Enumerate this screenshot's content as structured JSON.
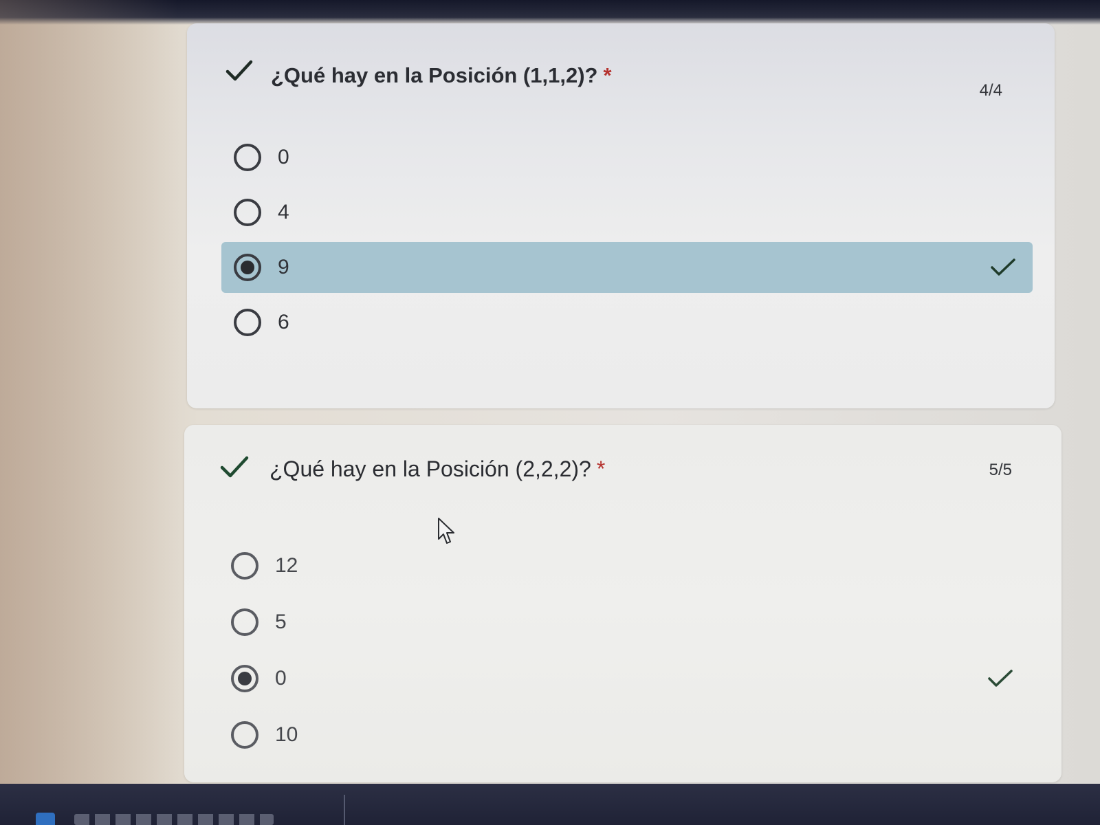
{
  "questions": [
    {
      "title": "¿Qué hay en la  Posición (1,1,2)?",
      "required_mark": "*",
      "score": "4/4",
      "options": [
        {
          "label": "0",
          "selected": false
        },
        {
          "label": "4",
          "selected": false
        },
        {
          "label": "9",
          "selected": true,
          "correct": true
        },
        {
          "label": "6",
          "selected": false
        }
      ]
    },
    {
      "title": "¿Qué hay en la Posición (2,2,2)?",
      "required_mark": "*",
      "score": "5/5",
      "options": [
        {
          "label": "12",
          "selected": false
        },
        {
          "label": "5",
          "selected": false
        },
        {
          "label": "0",
          "selected": true,
          "correct": true
        },
        {
          "label": "10",
          "selected": false
        }
      ]
    }
  ],
  "icons": {
    "title_check": "checkmark-icon",
    "option_check": "checkmark-icon",
    "cursor": "mouse-pointer-icon"
  },
  "colors": {
    "correct_highlight": "#a6c4d0",
    "required_mark": "#b5322e",
    "check_color": "#1f3b2a"
  }
}
